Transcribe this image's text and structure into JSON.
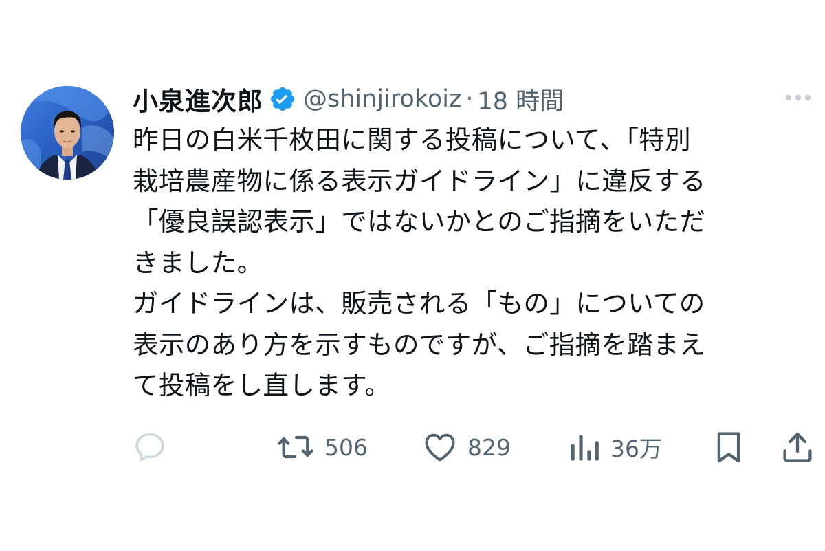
{
  "tweet": {
    "display_name": "小泉進次郎",
    "handle": "@shinjirokoiz",
    "separator": "·",
    "time": "18 時間",
    "lines": [
      "昨日の白米千枚田に関する投稿について、「特別",
      "栽培農産物に係る表示ガイドライン」に違反する",
      "「優良誤認表示」ではないかとのご指摘をいただ",
      "きました。",
      "ガイドラインは、販売される「もの」についての",
      "表示のあり方を示すものですが、ご指摘を踏まえ",
      "て投稿をし直します。"
    ]
  },
  "actions": {
    "replies": "",
    "reposts": "506",
    "likes": "829",
    "views": "36万"
  },
  "colors": {
    "text": "#0f1419",
    "secondary": "#536471",
    "verified": "#1d9bf0",
    "icon_light": "#cfd9de"
  },
  "icons": {
    "verified": "verified-badge-icon",
    "more": "more-dots-icon",
    "reply": "reply-bubble-icon",
    "repost": "repost-icon",
    "like": "heart-icon",
    "views": "views-bar-chart-icon",
    "bookmark": "bookmark-icon",
    "share": "share-upload-icon"
  }
}
